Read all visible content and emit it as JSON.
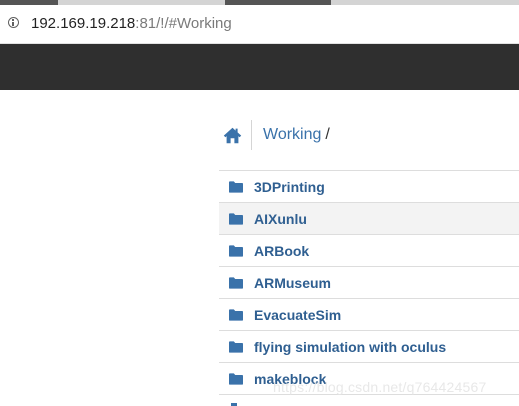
{
  "browser": {
    "url_host": "192.169.19.218",
    "url_rest": ":81/!/#Working"
  },
  "breadcrumb": {
    "home_icon": "home-icon",
    "current": "Working",
    "separator": "/"
  },
  "files": [
    {
      "name": "3DPrinting",
      "icon": "folder-icon"
    },
    {
      "name": "AIXunlu",
      "icon": "folder-icon",
      "hover": true
    },
    {
      "name": "ARBook",
      "icon": "folder-icon"
    },
    {
      "name": "ARMuseum",
      "icon": "folder-icon"
    },
    {
      "name": "EvacuateSim",
      "icon": "folder-icon"
    },
    {
      "name": "flying simulation with oculus",
      "icon": "folder-icon"
    },
    {
      "name": "makeblock",
      "icon": "folder-icon"
    }
  ],
  "watermark": "https://blog.csdn.net/q764424567",
  "colors": {
    "navbar": "#2f2f2f",
    "link": "#3a72aa",
    "folder": "#3a72aa",
    "row_hover": "#f3f3f3"
  }
}
